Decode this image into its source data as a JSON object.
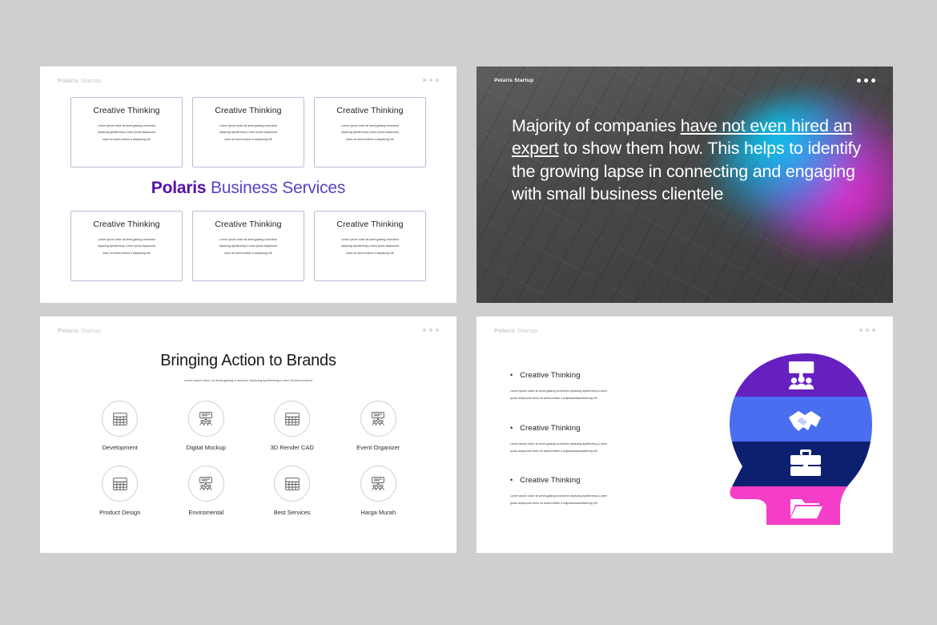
{
  "brand": {
    "bold": "Polaris",
    "light": " Startup"
  },
  "slide1": {
    "name": "Polaris Business Services cards slide",
    "headline_bold": "Polaris",
    "headline_light": " Business Services",
    "card_title": "Creative Thinking",
    "card_body_lines": [
      "Lorem ipsum dolor sit amet,galang croectetur",
      "dipiscing apellereequ,Lorem ipodu awipuuma",
      "dolor sit amet,ectetur a adipiscing elit"
    ],
    "cards_top": [
      "Creative Thinking",
      "Creative Thinking",
      "Creative Thinking"
    ],
    "cards_bottom": [
      "Creative Thinking",
      "Creative Thinking",
      "Creative Thinking"
    ],
    "card_border_color": "#c3b6d6",
    "accent_bold_color": "#5412a8",
    "accent_light_color": "#5b42c4"
  },
  "slide2": {
    "name": "Majority of companies statement slide",
    "text_part1": "Majority of companies ",
    "text_underlined": "have not even hired an expert",
    "text_part2": " to show them how. This helps to identify the growing lapse in connecting and engaging with small business clientele",
    "background_color": "#4a4a4a",
    "blob_colors": [
      "#00d6ff",
      "#ff28d7",
      "#963cf0"
    ]
  },
  "slide3": {
    "name": "Bringing Action to Brands icon grid slide",
    "title": "Bringing Action to Brands",
    "subtitle": "Lorem ipsum dolor sit amet,galang croectetur dipiscing apellereequ,Lorem sit amet,ectetur",
    "icons": [
      {
        "label": "Development",
        "icon": "calendar-grid-icon"
      },
      {
        "label": "Digital Mockup",
        "icon": "presentation-people-icon"
      },
      {
        "label": "3D Render CAD",
        "icon": "calendar-grid-icon"
      },
      {
        "label": "Event Organizer",
        "icon": "presentation-people-icon"
      },
      {
        "label": "Product Design",
        "icon": "calendar-grid-icon"
      },
      {
        "label": "Enviromental",
        "icon": "presentation-people-icon"
      },
      {
        "label": "Best Services",
        "icon": "calendar-grid-icon"
      },
      {
        "label": "Harga Murah",
        "icon": "presentation-people-icon"
      }
    ]
  },
  "slide4": {
    "name": "Creative Thinking bullets with head infographic slide",
    "bullets": [
      {
        "title": "Creative Thinking",
        "line1": "Lorem ipsum dolor sit amet,galang croectetur dipiscing apellereequ,Lorem",
        "line2": "ipodu awipuuma dolor sit amet,ectetur a adipisawdawdawficing elit"
      },
      {
        "title": "Creative Thinking",
        "line1": "Lorem ipsum dolor sit amet,galang croectetur dipiscing apellereequ,Lorem",
        "line2": "ipodu awipuuma dolor sit amet,ectetur a adipisawdawdawficing elit"
      },
      {
        "title": "Creative Thinking",
        "line1": "Lorem ipsum dolor sit amet,galang croectetur dipiscing apellereequ,Lorem",
        "line2": "ipodu awipuuma dolor sit amet,ectetur a adipisawdawdawficing elit"
      }
    ],
    "head_bands": [
      {
        "color": "#6620c0",
        "icon": "presentation-people-icon"
      },
      {
        "color": "#4a6ef0",
        "icon": "handshake-icon"
      },
      {
        "color": "#0d2070",
        "icon": "briefcase-icon"
      },
      {
        "color": "#f53ec8",
        "icon": "folder-icon"
      }
    ]
  }
}
